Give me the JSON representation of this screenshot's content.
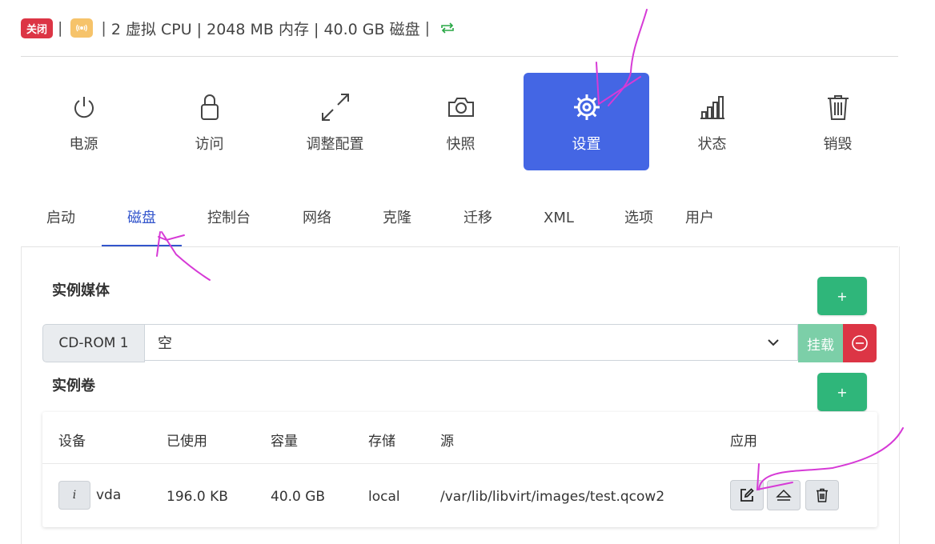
{
  "header": {
    "status_badge": "关闭",
    "specs": "2 虚拟 CPU | 2048 MB 内存 | 40.0 GB 磁盘",
    "icons": [
      "broadcast-icon",
      "sync-icon"
    ]
  },
  "actions": [
    {
      "label": "电源",
      "icon": "power-icon"
    },
    {
      "label": "访问",
      "icon": "lock-icon"
    },
    {
      "label": "调整配置",
      "icon": "resize-icon"
    },
    {
      "label": "快照",
      "icon": "camera-icon"
    },
    {
      "label": "设置",
      "icon": "gear-icon",
      "active": true
    },
    {
      "label": "状态",
      "icon": "bar-chart-icon"
    },
    {
      "label": "销毁",
      "icon": "trash-icon"
    }
  ],
  "tabs": [
    {
      "label": "启动"
    },
    {
      "label": "磁盘",
      "active": true
    },
    {
      "label": "控制台"
    },
    {
      "label": "网络"
    },
    {
      "label": "克隆"
    },
    {
      "label": "迁移"
    },
    {
      "label": "XML"
    },
    {
      "label": "选项"
    },
    {
      "label": "用户"
    }
  ],
  "media": {
    "title": "实例媒体",
    "add_label": "+",
    "cdrom_label": "CD-ROM 1",
    "selected": "空",
    "mount_label": "挂载"
  },
  "volumes": {
    "title": "实例卷",
    "add_label": "+",
    "columns": [
      "设备",
      "已使用",
      "容量",
      "存储",
      "源",
      "应用"
    ],
    "rows": [
      {
        "info": "i",
        "device": "vda",
        "used": "196.0 KB",
        "capacity": "40.0 GB",
        "storage": "local",
        "source": "/var/lib/libvirt/images/test.qcow2"
      }
    ]
  },
  "colors": {
    "primary": "#4466e4",
    "success": "#2fb67a",
    "danger": "#dc3545",
    "warning": "#f6c36a",
    "annotation": "#d63ad6"
  }
}
